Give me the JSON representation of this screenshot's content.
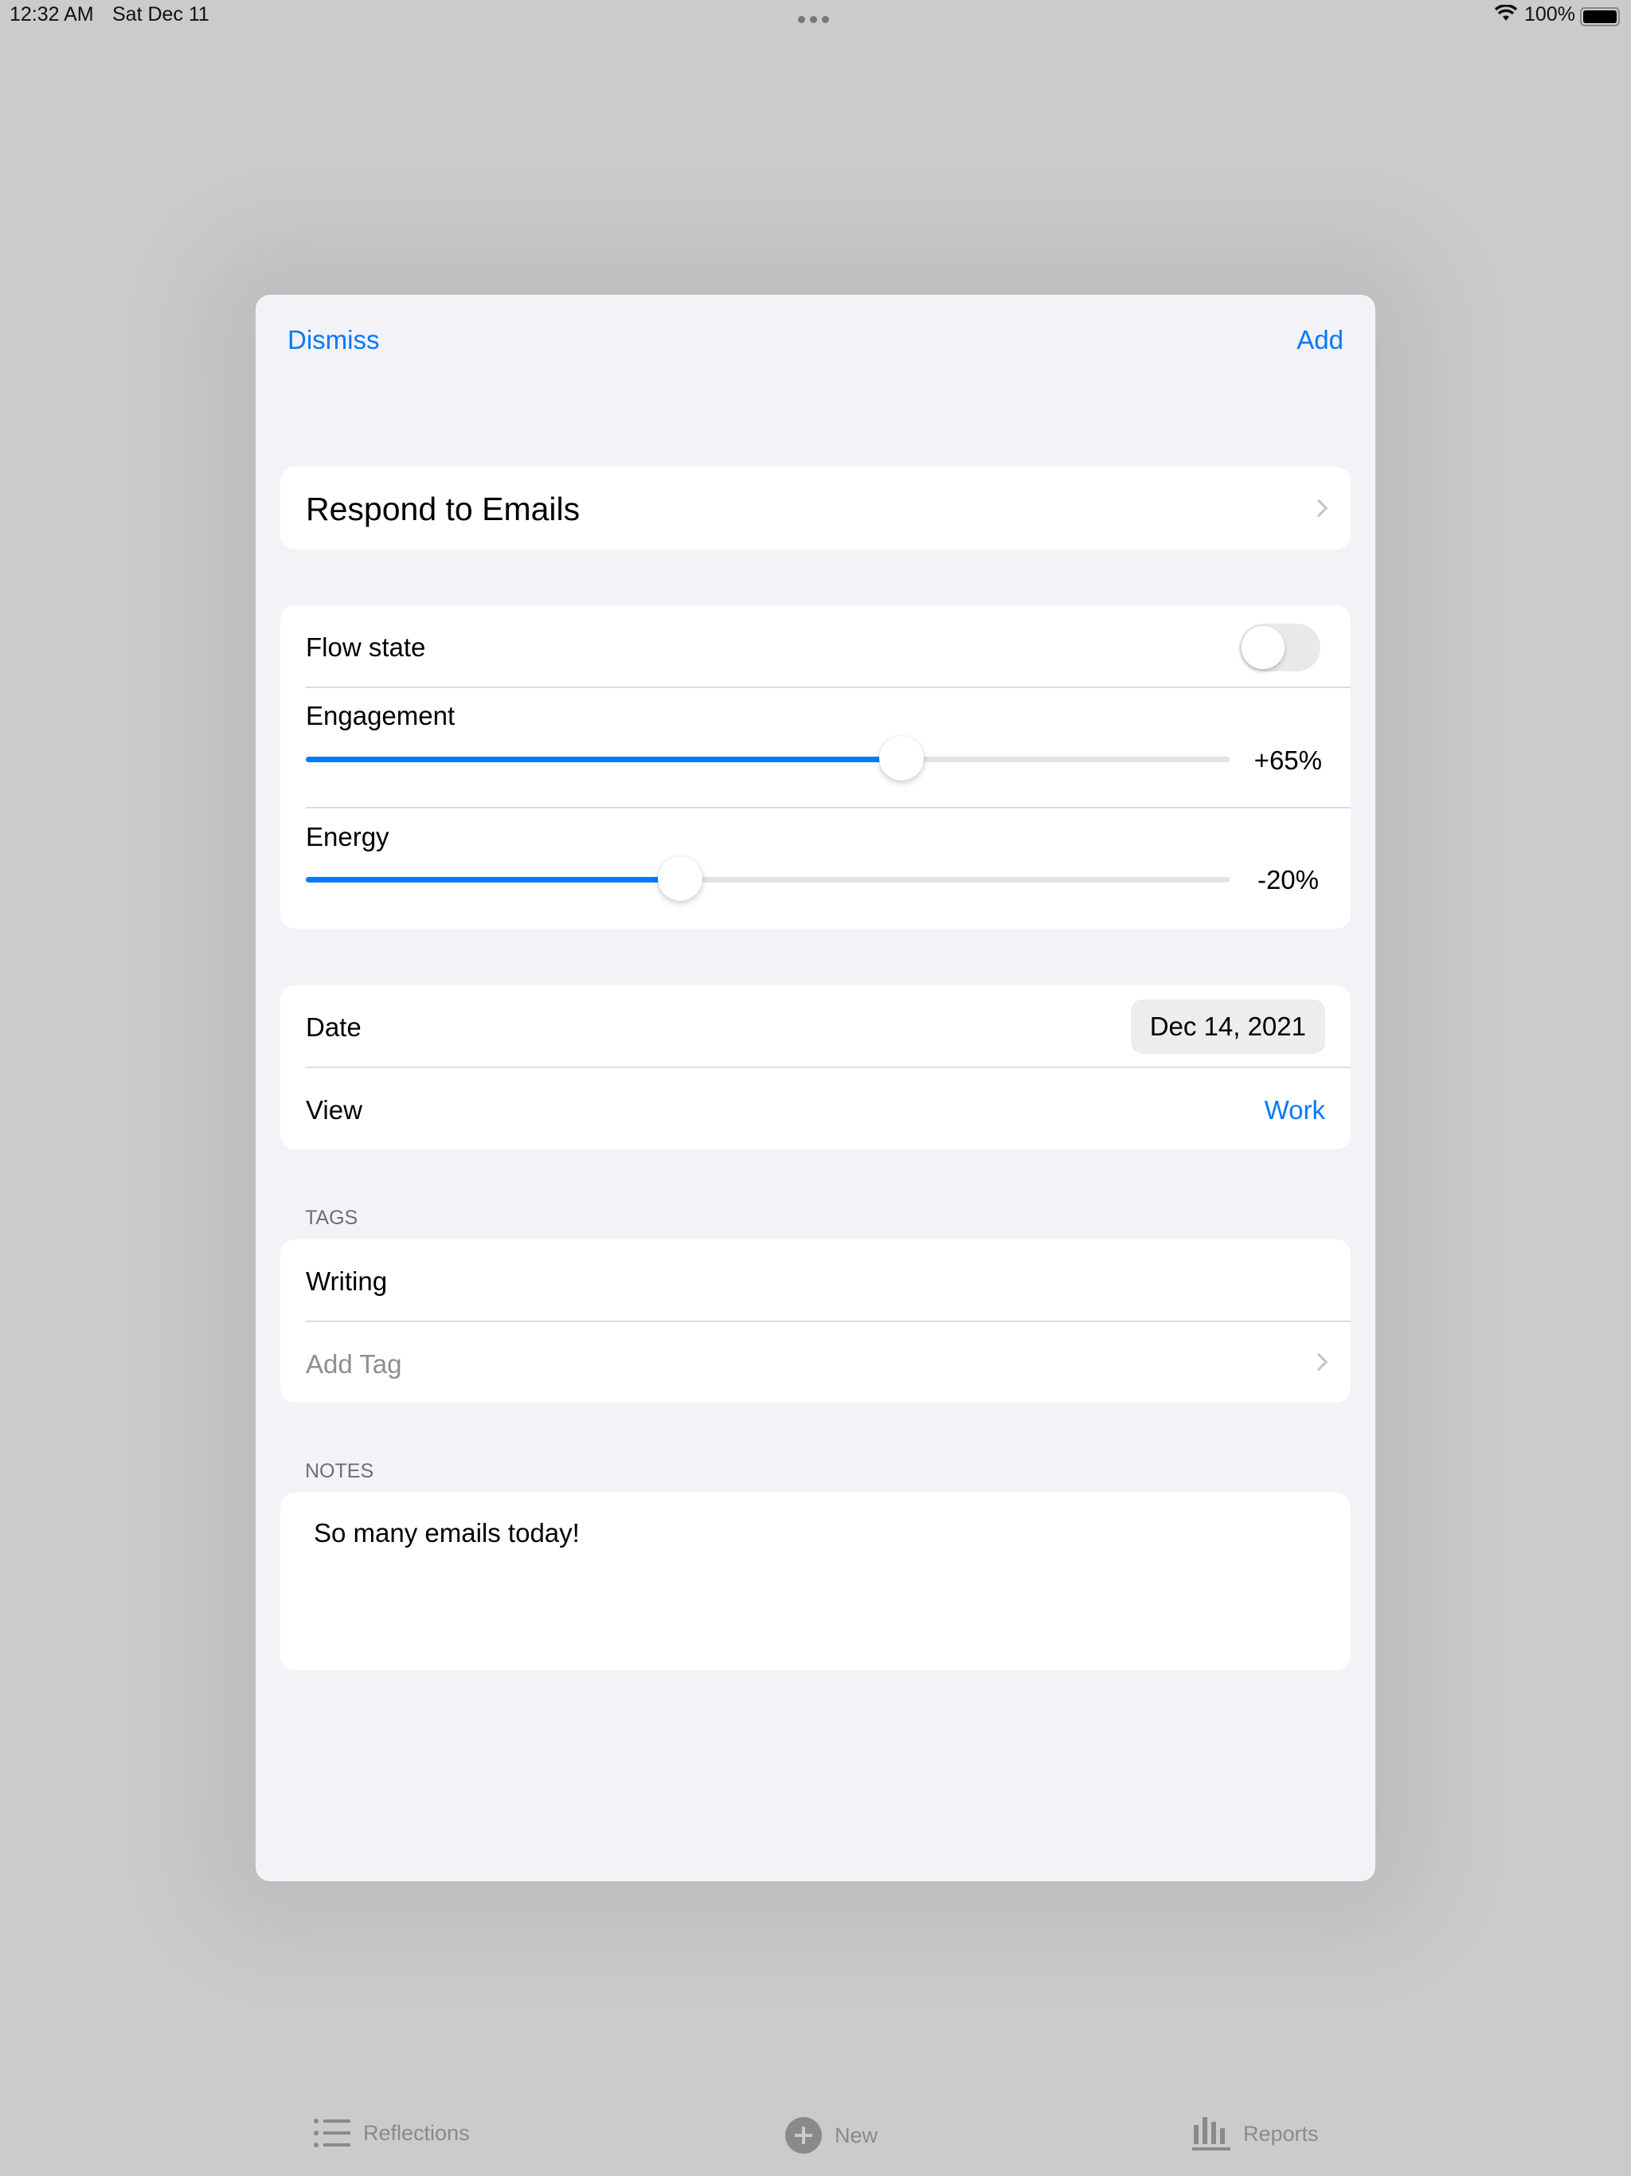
{
  "status_bar": {
    "time": "12:32 AM",
    "date": "Sat Dec 11",
    "battery": "100%"
  },
  "modal": {
    "dismiss": "Dismiss",
    "add": "Add",
    "activity": "Respond to Emails",
    "flow_state": {
      "label": "Flow state",
      "on": false
    },
    "engagement": {
      "label": "Engagement",
      "value_text": "+65%",
      "value": 65
    },
    "energy": {
      "label": "Energy",
      "value_text": "-20%",
      "value": -20
    },
    "date": {
      "label": "Date",
      "value": "Dec 14, 2021"
    },
    "view": {
      "label": "View",
      "value": "Work"
    },
    "tags": {
      "header": "TAGS",
      "items": [
        "Writing"
      ],
      "add": "Add Tag"
    },
    "notes": {
      "header": "NOTES",
      "text": "So many emails today!"
    }
  },
  "tabbar": {
    "items": [
      {
        "label": "Reflections",
        "icon": "list-icon"
      },
      {
        "label": "New",
        "icon": "plus-circle-icon"
      },
      {
        "label": "Reports",
        "icon": "bar-chart-icon"
      }
    ]
  },
  "colors": {
    "accent": "#007aff",
    "background": "#cbcbcb",
    "sheet": "#f2f2f7"
  }
}
